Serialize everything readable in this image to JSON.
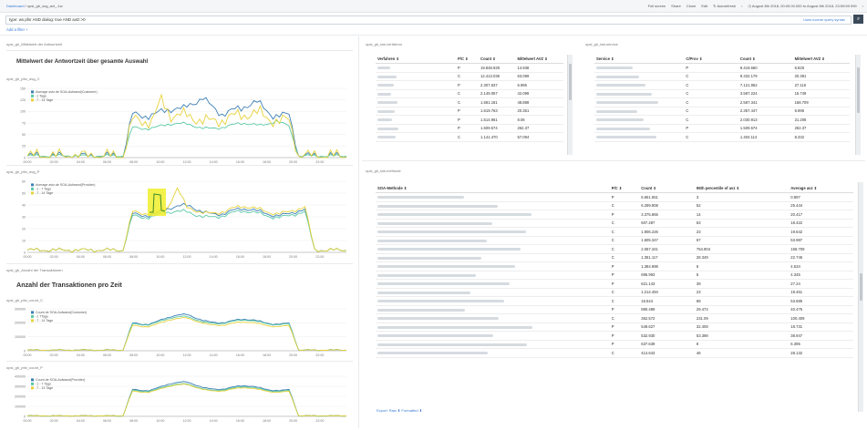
{
  "nav": {
    "crumb_root": "Dashboard",
    "crumb_sep": "/",
    "crumb_current": "opsl_gh_svg_avt_-1w",
    "full_screen": "Full screen",
    "share": "Share",
    "clone": "Clone",
    "edit": "Edit",
    "autorefresh": "Autorefresh",
    "time_range": "August 8th 2018, 00:00:00.000 to August 8th 2018, 23:59:59.999"
  },
  "query": {
    "text": "type: ws.pfsr AND dialog: true AND avtz:>0",
    "syntax_link": "Uses lucene query syntax"
  },
  "filter": {
    "add_label": "Add a filter +"
  },
  "left": {
    "section1_label": "opsl_gh_Mittelwert der Antwortzeit",
    "section1_heading": "Mittelwert der Antwortzeit über gesamte Auswahl",
    "section2_label": "opsl_gh_Anzahl der Transaktionen",
    "section2_heading": "Anzahl der Transaktionen pro Zeit",
    "charts": [
      {
        "title": "opsl_gh_pfsr_avg_C",
        "legend": [
          "Average avtz.de SOA-Aufwand(Customer)",
          "-1 Tage",
          "-7 - 14 Tage"
        ],
        "y_ticks": [
          "150",
          "125",
          "100",
          "75",
          "50",
          "25",
          "0"
        ],
        "x_ticks": [
          "00:00",
          "02:00",
          "04:00",
          "06:00",
          "08:00",
          "10:00",
          "12:00",
          "14:00",
          "16:00",
          "18:00",
          "20:00",
          "22:00"
        ]
      },
      {
        "title": "opsl_gh_pfsr_avg_P",
        "legend": [
          "Average avtz.de SOA-Aufwand(Provider)",
          "-1 - 7 Tage",
          "-7 - 14 Tage"
        ],
        "y_ticks": [
          "60",
          "50",
          "40",
          "30",
          "20",
          "10",
          "0"
        ],
        "x_ticks": [
          "00:00",
          "02:00",
          "04:00",
          "06:00",
          "08:00",
          "10:00",
          "12:00",
          "14:00",
          "16:00",
          "18:00",
          "20:00",
          "22:00"
        ]
      },
      {
        "title": "opsl_gh_pfsr_count_C",
        "legend": [
          "Count de SOA-Aufwand(Customer)",
          "-1 7Tage",
          "-7 - 14 Tage"
        ],
        "y_ticks": [
          "300000",
          "200000",
          "100000",
          "0"
        ],
        "x_ticks": [
          "00:00",
          "02:00",
          "04:00",
          "06:00",
          "08:00",
          "10:00",
          "12:00",
          "14:00",
          "16:00",
          "18:00",
          "20:00",
          "22:00"
        ]
      },
      {
        "title": "opsl_gh_pfsr_count_P",
        "legend": [
          "Count de SOA-Aufwand(Provider)",
          "-1 - 7 Tage",
          "-7 - 14 Tage"
        ],
        "y_ticks": [
          "400000",
          "300000",
          "200000",
          "100000",
          "0"
        ],
        "x_ticks": [
          "00:00",
          "02:00",
          "04:00",
          "06:00",
          "08:00",
          "10:00",
          "12:00",
          "14:00",
          "16:00",
          "18:00",
          "20:00",
          "22:00"
        ]
      }
    ]
  },
  "series_colors": {
    "current": "#3d7fb5",
    "week": "#5cc9a7",
    "twoweeks": "#e6d23c"
  },
  "verfahren": {
    "title": "opsl_gh_tab-verfahren",
    "headers": [
      "Verfahren",
      "P/C",
      "Count",
      "Mittelwert AVZ"
    ],
    "rows": [
      [
        "P",
        "19.848.929",
        "14.938"
      ],
      [
        "C",
        "12.413.036",
        "63.089"
      ],
      [
        "P",
        "2.307.637",
        "6.995"
      ],
      [
        "C",
        "2.149.057",
        "42.098"
      ],
      [
        "C",
        "1.681.181",
        "48.888"
      ],
      [
        "P",
        "1.619.763",
        "20.351"
      ],
      [
        "P",
        "1.514.961",
        "8.06"
      ],
      [
        "P",
        "1.509.574",
        "262.37"
      ],
      [
        "C",
        "1.141.470",
        "57.094"
      ]
    ]
  },
  "service": {
    "title": "opsl_gh_tab-service",
    "headers": [
      "Service",
      "C/Prov",
      "Count",
      "Mittelwert AVZ"
    ],
    "rows": [
      [
        "P",
        "9.419.560",
        "6.826"
      ],
      [
        "C",
        "9.332.179",
        "20.391"
      ],
      [
        "C",
        "7.121.952",
        "27.116"
      ],
      [
        "C",
        "3.587.224",
        "15.749"
      ],
      [
        "C",
        "2.587.341",
        "168.709"
      ],
      [
        "C",
        "2.357.447",
        "6.995"
      ],
      [
        "C",
        "2.030.913",
        "21.206"
      ],
      [
        "P",
        "1.509.574",
        "262.37"
      ],
      [
        "C",
        "1.404.114",
        "8.332"
      ]
    ]
  },
  "methode": {
    "title": "opsl_gh_tab-methode",
    "headers": [
      "SOA-Methode",
      "P/C",
      "Count",
      "95th percentile of avz",
      "Average avz"
    ],
    "rows": [
      [
        "P",
        "6.651.651",
        "3",
        "0.897"
      ],
      [
        "C",
        "6.299.908",
        "52",
        "25.444"
      ],
      [
        "P",
        "3.375.865",
        "14",
        "20.417"
      ],
      [
        "C",
        "607.287",
        "53",
        "18.422"
      ],
      [
        "C",
        "1.906.226",
        "23",
        "19.642"
      ],
      [
        "C",
        "1.605.347",
        "67",
        "53.987"
      ],
      [
        "C",
        "2.067.341",
        "754.904",
        "168.709"
      ],
      [
        "C",
        "1.351.117",
        "28.349",
        "22.746"
      ],
      [
        "P",
        "1.384.998",
        "6",
        "4.534"
      ],
      [
        "P",
        "695.993",
        "5",
        "4.345"
      ],
      [
        "P",
        "621.143",
        "39",
        "27.24"
      ],
      [
        "C",
        "1.214.494",
        "23",
        "19.461"
      ],
      [
        "C",
        "16.544",
        "68",
        "53.685"
      ],
      [
        "P",
        "890.499",
        "29.474",
        "40.475"
      ],
      [
        "C",
        "362.572",
        "231.09",
        "100.409"
      ],
      [
        "P",
        "549.627",
        "32.408",
        "18.731"
      ],
      [
        "P",
        "532.930",
        "53.398",
        "38.947"
      ],
      [
        "P",
        "637.639",
        "8",
        "6.395"
      ],
      [
        "C",
        "414.643",
        "46",
        "28.132"
      ]
    ],
    "pagination": "Export: Raw ⬇ Formatted ⬇"
  }
}
